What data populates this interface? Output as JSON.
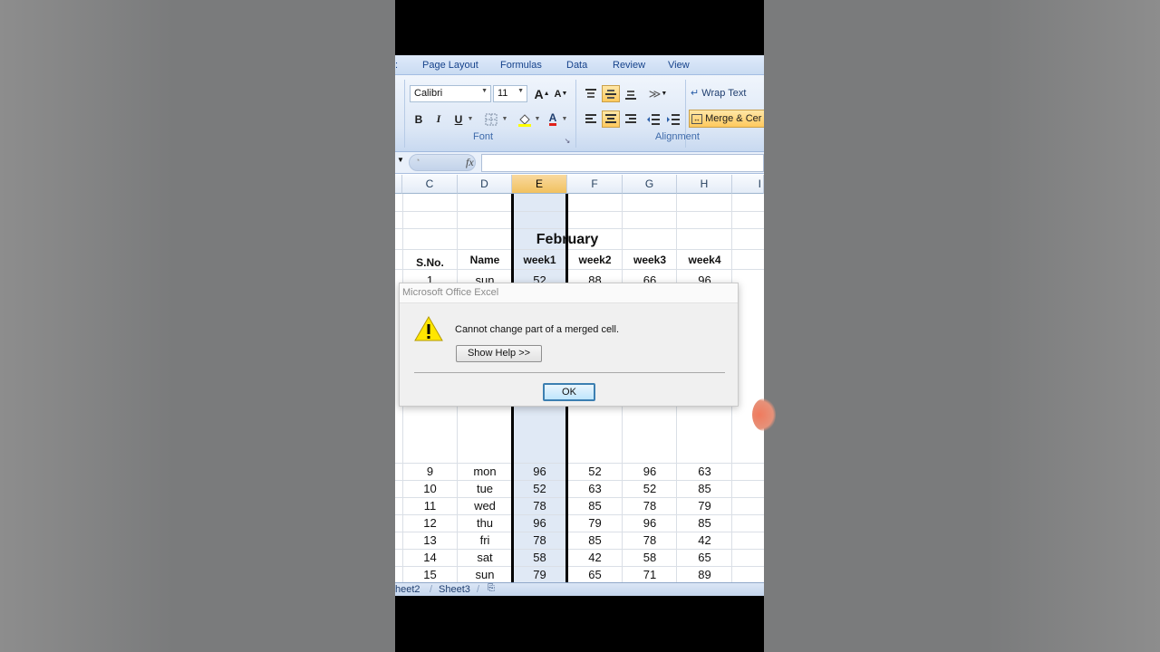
{
  "ribbon": {
    "tabs": [
      "Page Layout",
      "Formulas",
      "Data",
      "Review",
      "View"
    ],
    "font_name": "Calibri",
    "font_size": "11",
    "bold_label": "B",
    "italic_label": "I",
    "underline_label": "U",
    "grow_font_label": "A",
    "shrink_font_label": "A",
    "font_color_label": "A",
    "font_group_label": "Font",
    "alignment_group_label": "Alignment",
    "wrap_text_label": "Wrap Text",
    "merge_center_label": "Merge & Cer"
  },
  "formula_bar": {
    "fx_label": "fx",
    "value": ""
  },
  "grid": {
    "columns": [
      "C",
      "D",
      "E",
      "F",
      "G",
      "H",
      "I"
    ],
    "selected_column": "E",
    "title": "February",
    "headers": [
      "S.No.",
      "Name",
      "week1",
      "week2",
      "week3",
      "week4"
    ],
    "partial_row": [
      "1",
      "sun",
      "52",
      "88",
      "66",
      "96"
    ],
    "rows": [
      [
        "9",
        "mon",
        "96",
        "52",
        "96",
        "63"
      ],
      [
        "10",
        "tue",
        "52",
        "63",
        "52",
        "85"
      ],
      [
        "11",
        "wed",
        "78",
        "85",
        "78",
        "79"
      ],
      [
        "12",
        "thu",
        "96",
        "79",
        "96",
        "85"
      ],
      [
        "13",
        "fri",
        "78",
        "85",
        "78",
        "42"
      ],
      [
        "14",
        "sat",
        "58",
        "42",
        "58",
        "65"
      ],
      [
        "15",
        "sun",
        "79",
        "65",
        "71",
        "89"
      ]
    ]
  },
  "sheet_tabs": [
    "heet2",
    "Sheet3"
  ],
  "dialog": {
    "title": "Microsoft Office Excel",
    "message": "Cannot change part of a merged cell.",
    "help_button": "Show Help >>",
    "ok_button": "OK"
  },
  "colors": {
    "accent": "#15428b",
    "selected_header": "#f1c15f",
    "ok_border": "#3c7fb1"
  }
}
